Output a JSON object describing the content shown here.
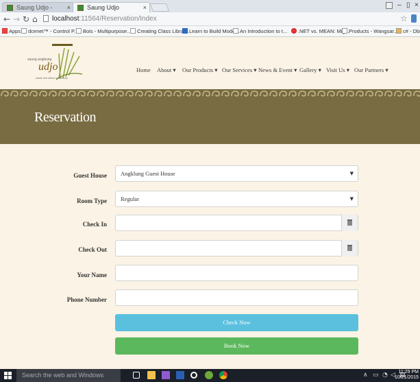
{
  "browser": {
    "tabs": [
      {
        "label": "Saung Udjo - Admin",
        "close": "×"
      },
      {
        "label": "Saung Udjo",
        "close": "×"
      }
    ],
    "url_host": "localhost",
    "url_path": ":11564/Reservation/Index",
    "bookmarks": [
      "Apps",
      "dcenet™ - Control P...",
      "Bois - Multipurpose...",
      "Creating Class Librar...",
      "Learn to Build Mode...",
      "An Introduction to t...",
      ".NET vs. MEAN: Mig...",
      "Products - Wangsar...",
      "c# - DbEntityValidati..."
    ]
  },
  "site": {
    "logo_tagline": "saung angklung",
    "logo_name": "udjo",
    "logo_subtitle": "nature and culture in harmony",
    "nav": [
      "Home",
      "About ▾",
      "Our Products ▾",
      "Our Services ▾",
      "News & Event ▾",
      "Gallery ▾",
      "Visit Us ▾",
      "Our Partners ▾"
    ],
    "page_title": "Reservation"
  },
  "form": {
    "guest_house_label": "Guest House",
    "guest_house_value": "Angklung Guest House",
    "room_type_label": "Room Type",
    "room_type_value": "Regular",
    "check_in_label": "Check In",
    "check_in_value": "",
    "check_out_label": "Check Out",
    "check_out_value": "",
    "your_name_label": "Your Name",
    "your_name_value": "",
    "phone_label": "Phone Number",
    "phone_value": "",
    "check_now_label": "Check Now",
    "book_now_label": "Book Now"
  },
  "taskbar": {
    "search_placeholder": "Search the web and Windows",
    "time": "11:29 PM",
    "date": "10/21/2015"
  },
  "colors": {
    "brown_band": "#7a6c42",
    "check_button": "#5bc0de",
    "book_button": "#5cb85c"
  }
}
